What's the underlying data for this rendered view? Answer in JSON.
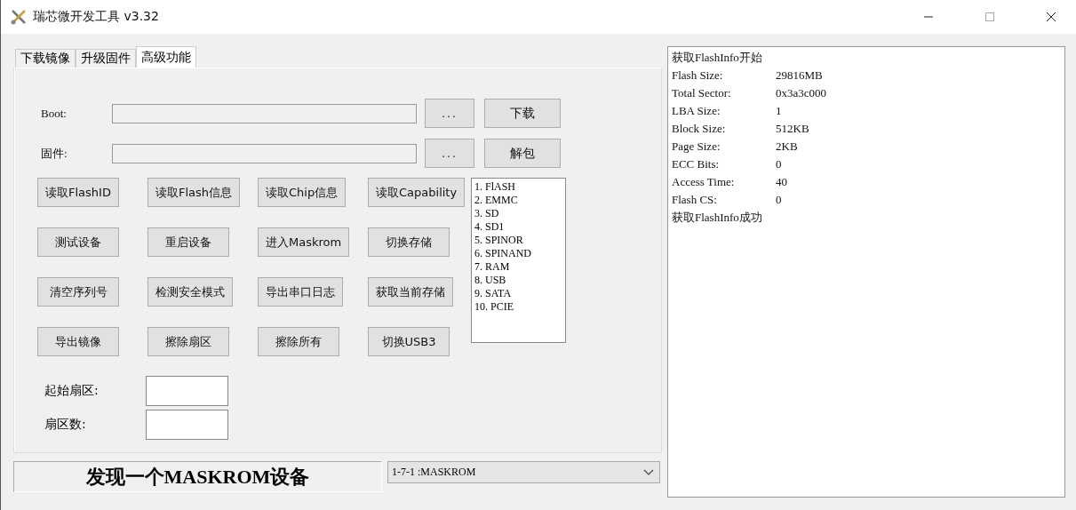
{
  "window": {
    "title": "瑞芯微开发工具 v3.32"
  },
  "tabs": [
    {
      "label": "下载镜像",
      "selected": false
    },
    {
      "label": "升级固件",
      "selected": false
    },
    {
      "label": "高级功能",
      "selected": true
    }
  ],
  "file_rows": [
    {
      "label": "Boot:",
      "browse": "...",
      "action": "下载"
    },
    {
      "label": "固件:",
      "browse": "...",
      "action": "解包"
    }
  ],
  "actions": [
    [
      "读取FlashID",
      "读取Flash信息",
      "读取Chip信息",
      "读取Capability"
    ],
    [
      "测试设备",
      "重启设备",
      "进入Maskrom",
      "切换存储"
    ],
    [
      "清空序列号",
      "检测安全模式",
      "导出串口日志",
      "获取当前存储"
    ],
    [
      "导出镜像",
      "擦除扇区",
      "擦除所有",
      "切换USB3"
    ]
  ],
  "storage_list": [
    "1.  FlASH",
    "2.  EMMC",
    "3.  SD",
    "4.  SD1",
    "5.  SPINOR",
    "6.  SPINAND",
    "7.  RAM",
    "8.  USB",
    "9.  SATA",
    "10.  PCIE"
  ],
  "sector_fields": [
    {
      "label": "起始扇区:"
    },
    {
      "label": "扇区数:"
    }
  ],
  "status": "发现一个MASKROM设备",
  "device_select": {
    "value": "1-7-1  :MASKROM"
  },
  "log": [
    {
      "kind": "text",
      "text": "获取FlashInfo开始"
    },
    {
      "kind": "pair",
      "key": "Flash Size:",
      "value": "29816MB"
    },
    {
      "kind": "pair",
      "key": "Total Sector:",
      "value": "0x3a3c000"
    },
    {
      "kind": "pair",
      "key": "LBA Size:",
      "value": "1"
    },
    {
      "kind": "pair",
      "key": "Block Size:",
      "value": "512KB"
    },
    {
      "kind": "pair",
      "key": "Page Size:",
      "value": "2KB"
    },
    {
      "kind": "pair",
      "key": "ECC Bits:",
      "value": "0"
    },
    {
      "kind": "pair",
      "key": "Access Time:",
      "value": "40"
    },
    {
      "kind": "pair",
      "key": "Flash CS:",
      "value": "0"
    },
    {
      "kind": "text",
      "text": "获取FlashInfo成功"
    }
  ]
}
